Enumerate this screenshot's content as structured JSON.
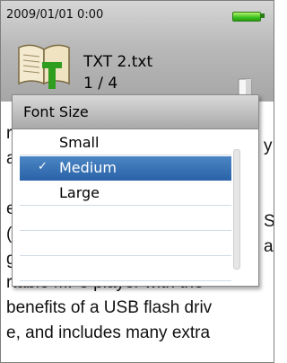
{
  "status": {
    "datetime": "2009/01/01  0:00",
    "battery_icon": "battery-full-icon"
  },
  "file": {
    "name": "TXT 2.txt",
    "page": "1 / 4",
    "icon": "ebook-icon"
  },
  "background_text": [
    "r",
    "a",
    "e",
    "(",
    "g",
    "rtable MP3 player with the",
    "benefits of a USB flash driv",
    "e, and includes many extra"
  ],
  "background_right_chars": [
    "y",
    "S",
    "a"
  ],
  "popup": {
    "title": "Font Size",
    "options": [
      {
        "label": "Small",
        "selected": false
      },
      {
        "label": "Medium",
        "selected": true
      },
      {
        "label": "Large",
        "selected": false
      },
      {
        "label": "",
        "selected": false
      },
      {
        "label": "",
        "selected": false
      },
      {
        "label": "",
        "selected": false
      },
      {
        "label": "",
        "selected": false
      }
    ]
  },
  "colors": {
    "selection": "#2b63a8",
    "battery": "#39c21e"
  }
}
